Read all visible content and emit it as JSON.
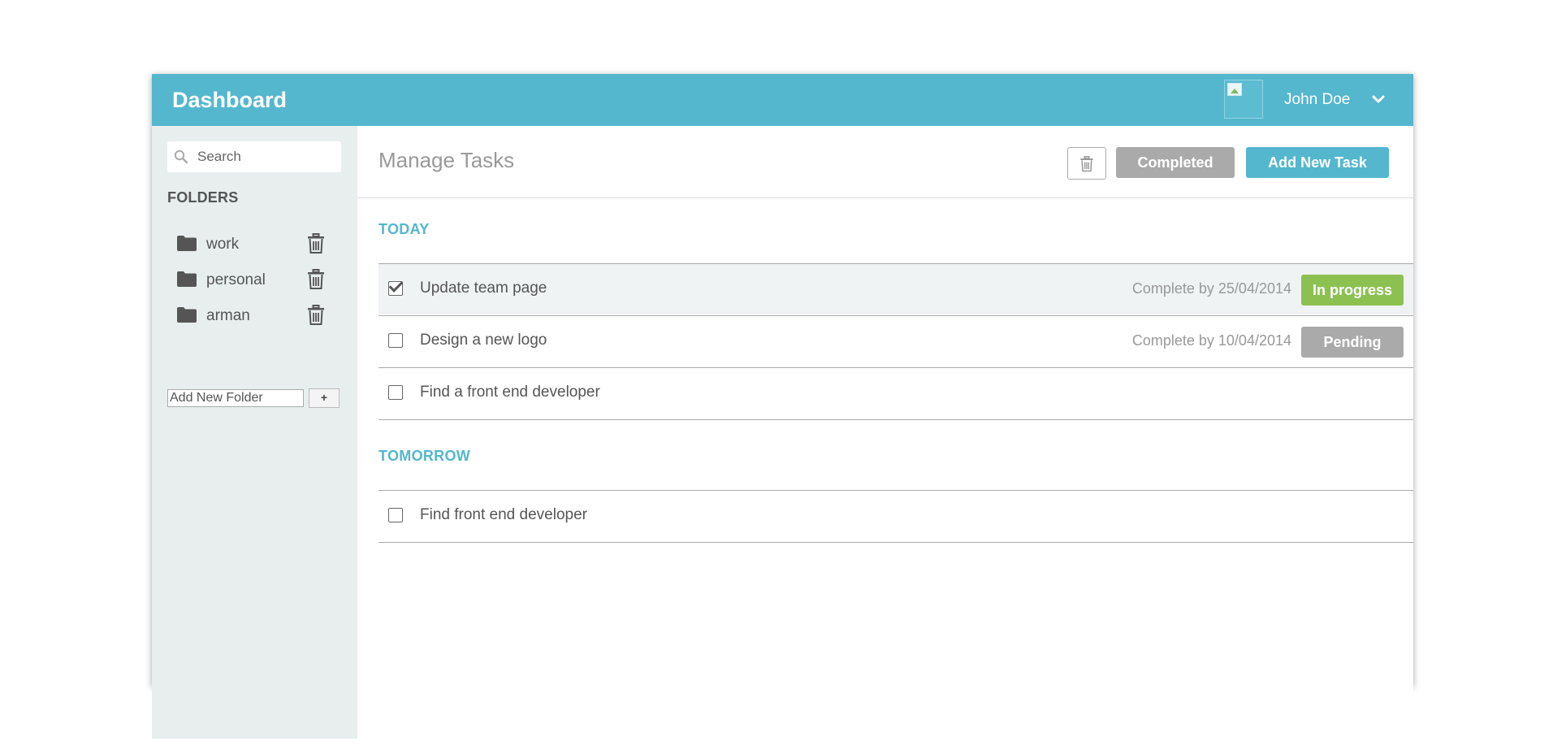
{
  "header": {
    "title": "Dashboard",
    "user_name": "John Doe",
    "color": "#54b7ce"
  },
  "sidebar": {
    "search_placeholder": "Search",
    "folders_title": "FOLDERS",
    "folders": [
      {
        "name": "work",
        "icon": "folder-icon"
      },
      {
        "name": "personal",
        "icon": "folder-icon"
      },
      {
        "name": "arman",
        "icon": "folder-icon"
      }
    ],
    "add_folder_placeholder": "Add New Folder",
    "add_folder_button": "+"
  },
  "main": {
    "title": "Manage Tasks",
    "completed_label": "Completed",
    "add_task_label": "Add New Task",
    "sections": [
      {
        "title": "TODAY",
        "tasks": [
          {
            "name": "Update team page",
            "checked": true,
            "due": "Complete by 25/04/2014",
            "status": "In progress",
            "status_color": "#8cc152"
          },
          {
            "name": "Design a new logo",
            "checked": false,
            "due": "Complete by 10/04/2014",
            "status": "Pending",
            "status_color": "#aaaaaa"
          },
          {
            "name": "Find a front end developer",
            "checked": false
          }
        ]
      },
      {
        "title": "TOMORROW",
        "tasks": [
          {
            "name": "Find front end developer",
            "checked": false
          }
        ]
      }
    ]
  }
}
